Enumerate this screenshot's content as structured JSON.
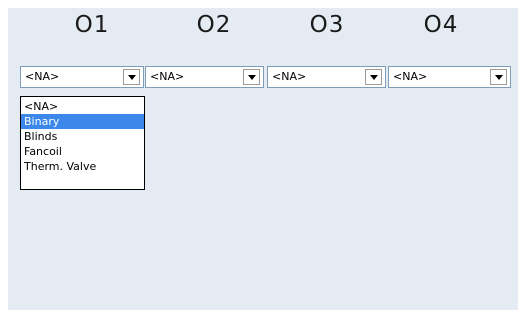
{
  "columns": [
    {
      "header": "O1",
      "value": "<NA>"
    },
    {
      "header": "O2",
      "value": "<NA>"
    },
    {
      "header": "O3",
      "value": "<NA>"
    },
    {
      "header": "O4",
      "value": "<NA>"
    }
  ],
  "dropdown": {
    "options": [
      "<NA>",
      "Binary",
      "Blinds",
      "Fancoil",
      "Therm. Valve"
    ],
    "highlighted": "Binary"
  },
  "colors": {
    "panel_bg": "#e4ebf2",
    "highlight": "#3b87ea",
    "combo_border": "#7f9db9"
  },
  "icons": {
    "combo_button": "chevron-down-icon"
  }
}
